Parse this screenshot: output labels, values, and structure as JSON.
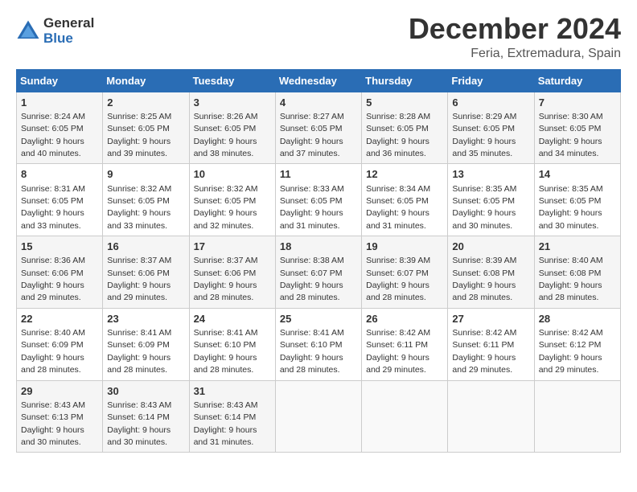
{
  "logo": {
    "general": "General",
    "blue": "Blue"
  },
  "title": "December 2024",
  "location": "Feria, Extremadura, Spain",
  "weekdays": [
    "Sunday",
    "Monday",
    "Tuesday",
    "Wednesday",
    "Thursday",
    "Friday",
    "Saturday"
  ],
  "weeks": [
    [
      {
        "day": "1",
        "sunrise": "Sunrise: 8:24 AM",
        "sunset": "Sunset: 6:05 PM",
        "daylight": "Daylight: 9 hours and 40 minutes."
      },
      {
        "day": "2",
        "sunrise": "Sunrise: 8:25 AM",
        "sunset": "Sunset: 6:05 PM",
        "daylight": "Daylight: 9 hours and 39 minutes."
      },
      {
        "day": "3",
        "sunrise": "Sunrise: 8:26 AM",
        "sunset": "Sunset: 6:05 PM",
        "daylight": "Daylight: 9 hours and 38 minutes."
      },
      {
        "day": "4",
        "sunrise": "Sunrise: 8:27 AM",
        "sunset": "Sunset: 6:05 PM",
        "daylight": "Daylight: 9 hours and 37 minutes."
      },
      {
        "day": "5",
        "sunrise": "Sunrise: 8:28 AM",
        "sunset": "Sunset: 6:05 PM",
        "daylight": "Daylight: 9 hours and 36 minutes."
      },
      {
        "day": "6",
        "sunrise": "Sunrise: 8:29 AM",
        "sunset": "Sunset: 6:05 PM",
        "daylight": "Daylight: 9 hours and 35 minutes."
      },
      {
        "day": "7",
        "sunrise": "Sunrise: 8:30 AM",
        "sunset": "Sunset: 6:05 PM",
        "daylight": "Daylight: 9 hours and 34 minutes."
      }
    ],
    [
      {
        "day": "8",
        "sunrise": "Sunrise: 8:31 AM",
        "sunset": "Sunset: 6:05 PM",
        "daylight": "Daylight: 9 hours and 33 minutes."
      },
      {
        "day": "9",
        "sunrise": "Sunrise: 8:32 AM",
        "sunset": "Sunset: 6:05 PM",
        "daylight": "Daylight: 9 hours and 33 minutes."
      },
      {
        "day": "10",
        "sunrise": "Sunrise: 8:32 AM",
        "sunset": "Sunset: 6:05 PM",
        "daylight": "Daylight: 9 hours and 32 minutes."
      },
      {
        "day": "11",
        "sunrise": "Sunrise: 8:33 AM",
        "sunset": "Sunset: 6:05 PM",
        "daylight": "Daylight: 9 hours and 31 minutes."
      },
      {
        "day": "12",
        "sunrise": "Sunrise: 8:34 AM",
        "sunset": "Sunset: 6:05 PM",
        "daylight": "Daylight: 9 hours and 31 minutes."
      },
      {
        "day": "13",
        "sunrise": "Sunrise: 8:35 AM",
        "sunset": "Sunset: 6:05 PM",
        "daylight": "Daylight: 9 hours and 30 minutes."
      },
      {
        "day": "14",
        "sunrise": "Sunrise: 8:35 AM",
        "sunset": "Sunset: 6:05 PM",
        "daylight": "Daylight: 9 hours and 30 minutes."
      }
    ],
    [
      {
        "day": "15",
        "sunrise": "Sunrise: 8:36 AM",
        "sunset": "Sunset: 6:06 PM",
        "daylight": "Daylight: 9 hours and 29 minutes."
      },
      {
        "day": "16",
        "sunrise": "Sunrise: 8:37 AM",
        "sunset": "Sunset: 6:06 PM",
        "daylight": "Daylight: 9 hours and 29 minutes."
      },
      {
        "day": "17",
        "sunrise": "Sunrise: 8:37 AM",
        "sunset": "Sunset: 6:06 PM",
        "daylight": "Daylight: 9 hours and 28 minutes."
      },
      {
        "day": "18",
        "sunrise": "Sunrise: 8:38 AM",
        "sunset": "Sunset: 6:07 PM",
        "daylight": "Daylight: 9 hours and 28 minutes."
      },
      {
        "day": "19",
        "sunrise": "Sunrise: 8:39 AM",
        "sunset": "Sunset: 6:07 PM",
        "daylight": "Daylight: 9 hours and 28 minutes."
      },
      {
        "day": "20",
        "sunrise": "Sunrise: 8:39 AM",
        "sunset": "Sunset: 6:08 PM",
        "daylight": "Daylight: 9 hours and 28 minutes."
      },
      {
        "day": "21",
        "sunrise": "Sunrise: 8:40 AM",
        "sunset": "Sunset: 6:08 PM",
        "daylight": "Daylight: 9 hours and 28 minutes."
      }
    ],
    [
      {
        "day": "22",
        "sunrise": "Sunrise: 8:40 AM",
        "sunset": "Sunset: 6:09 PM",
        "daylight": "Daylight: 9 hours and 28 minutes."
      },
      {
        "day": "23",
        "sunrise": "Sunrise: 8:41 AM",
        "sunset": "Sunset: 6:09 PM",
        "daylight": "Daylight: 9 hours and 28 minutes."
      },
      {
        "day": "24",
        "sunrise": "Sunrise: 8:41 AM",
        "sunset": "Sunset: 6:10 PM",
        "daylight": "Daylight: 9 hours and 28 minutes."
      },
      {
        "day": "25",
        "sunrise": "Sunrise: 8:41 AM",
        "sunset": "Sunset: 6:10 PM",
        "daylight": "Daylight: 9 hours and 28 minutes."
      },
      {
        "day": "26",
        "sunrise": "Sunrise: 8:42 AM",
        "sunset": "Sunset: 6:11 PM",
        "daylight": "Daylight: 9 hours and 29 minutes."
      },
      {
        "day": "27",
        "sunrise": "Sunrise: 8:42 AM",
        "sunset": "Sunset: 6:11 PM",
        "daylight": "Daylight: 9 hours and 29 minutes."
      },
      {
        "day": "28",
        "sunrise": "Sunrise: 8:42 AM",
        "sunset": "Sunset: 6:12 PM",
        "daylight": "Daylight: 9 hours and 29 minutes."
      }
    ],
    [
      {
        "day": "29",
        "sunrise": "Sunrise: 8:43 AM",
        "sunset": "Sunset: 6:13 PM",
        "daylight": "Daylight: 9 hours and 30 minutes."
      },
      {
        "day": "30",
        "sunrise": "Sunrise: 8:43 AM",
        "sunset": "Sunset: 6:14 PM",
        "daylight": "Daylight: 9 hours and 30 minutes."
      },
      {
        "day": "31",
        "sunrise": "Sunrise: 8:43 AM",
        "sunset": "Sunset: 6:14 PM",
        "daylight": "Daylight: 9 hours and 31 minutes."
      },
      null,
      null,
      null,
      null
    ]
  ]
}
